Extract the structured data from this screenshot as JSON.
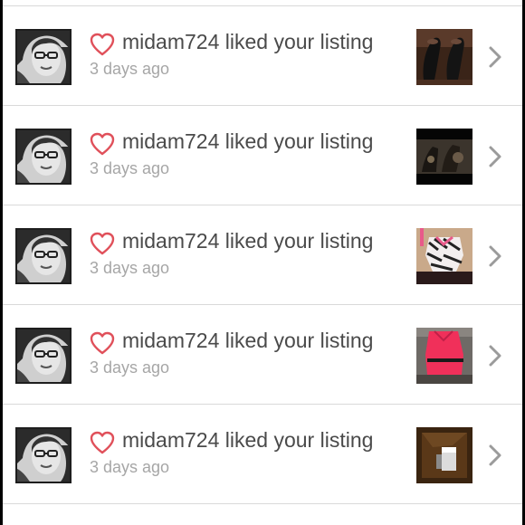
{
  "notifications": [
    {
      "username": "midam724",
      "action": "liked your listing",
      "time": "3 days ago",
      "thumbnail": "black-shoes"
    },
    {
      "username": "midam724",
      "action": "liked your listing",
      "time": "3 days ago",
      "thumbnail": "boots-on-dark"
    },
    {
      "username": "midam724",
      "action": "liked your listing",
      "time": "3 days ago",
      "thumbnail": "zebra-top"
    },
    {
      "username": "midam724",
      "action": "liked your listing",
      "time": "3 days ago",
      "thumbnail": "pink-dress"
    },
    {
      "username": "midam724",
      "action": "liked your listing",
      "time": "3 days ago",
      "thumbnail": "brown-item"
    }
  ],
  "icons": {
    "heart": "heart-outline-icon",
    "chevron": "chevron-right-icon"
  },
  "colors": {
    "heart": "#e0505a",
    "title": "#4a4a4a",
    "timestamp": "#a6a6a6",
    "divider": "#d9d9d9",
    "chevron": "#9b9b9b"
  }
}
